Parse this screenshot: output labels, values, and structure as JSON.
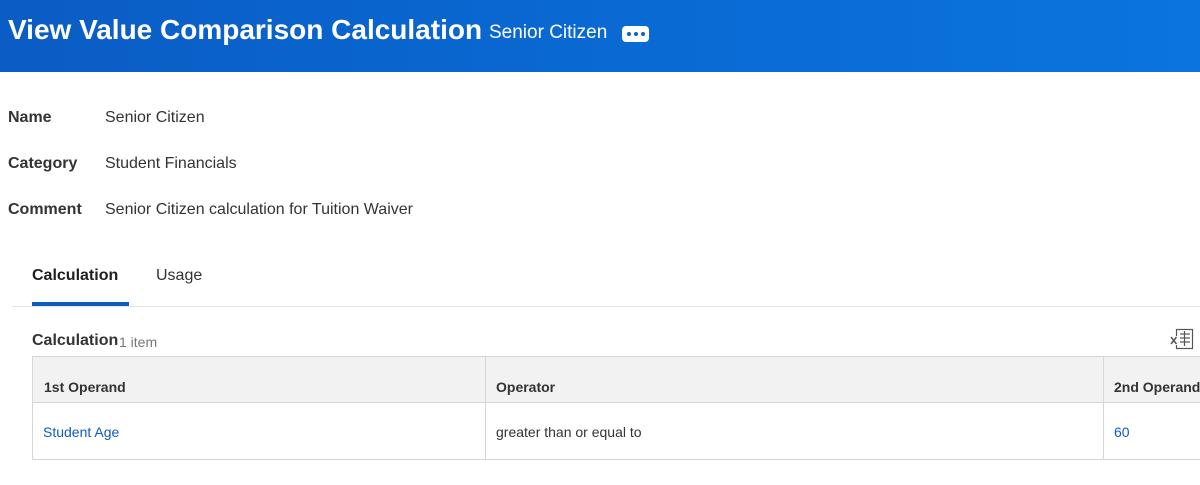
{
  "header": {
    "title": "View Value Comparison Calculation",
    "subtitle": "Senior Citizen",
    "more_icon": "more-horizontal-icon"
  },
  "fields": [
    {
      "label": "Name",
      "value": "Senior Citizen"
    },
    {
      "label": "Category",
      "value": "Student Financials"
    },
    {
      "label": "Comment",
      "value": "Senior Citizen calculation for Tuition Waiver"
    }
  ],
  "tabs": [
    {
      "label": "Calculation",
      "active": true
    },
    {
      "label": "Usage",
      "active": false
    }
  ],
  "section": {
    "title": "Calculation",
    "count": "1 item",
    "export_icon": "export-to-excel-icon"
  },
  "table": {
    "columns": [
      "1st Operand",
      "Operator",
      "2nd Operand"
    ],
    "rows": [
      [
        "Student Age",
        "greater than or equal to",
        "60"
      ]
    ]
  },
  "colors": {
    "header_bg": "#0b5cc4",
    "link": "#0b5cc4",
    "tab_active_underline": "#0b5cc4"
  }
}
